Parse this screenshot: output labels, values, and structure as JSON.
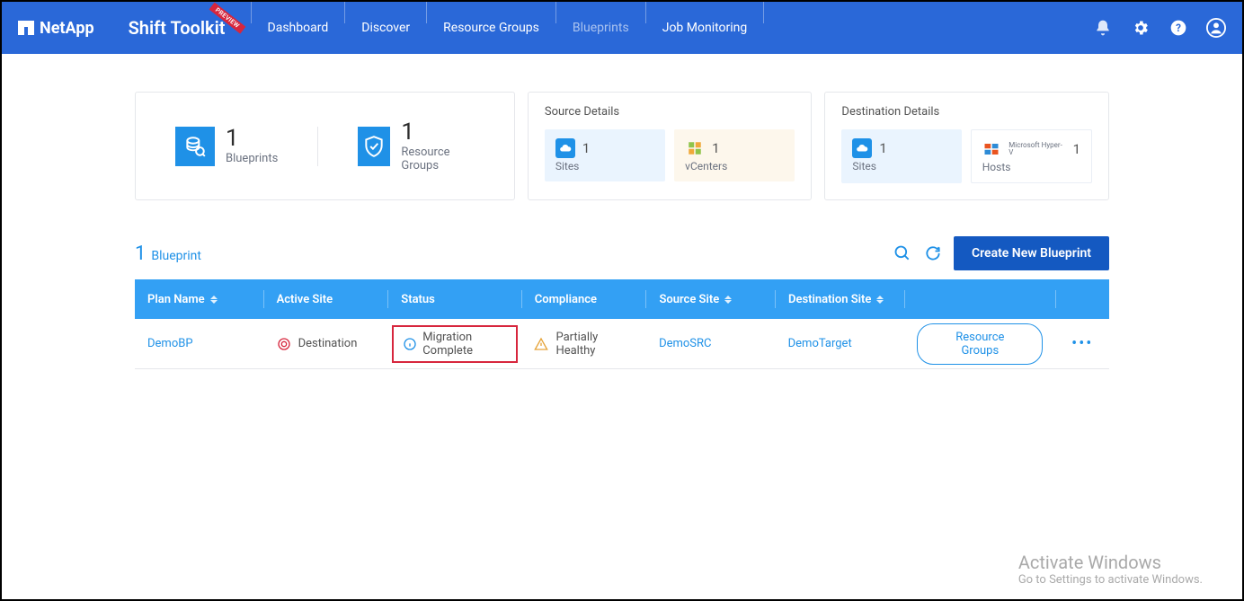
{
  "header": {
    "brand": "NetApp",
    "product": "Shift Toolkit",
    "ribbon": "PREVIEW",
    "nav": [
      "Dashboard",
      "Discover",
      "Resource Groups",
      "Blueprints",
      "Job Monitoring"
    ],
    "active_nav_index": 3
  },
  "summary": {
    "blueprints": {
      "count": "1",
      "label": "Blueprints"
    },
    "resource_groups": {
      "count": "1",
      "label": "Resource Groups"
    },
    "source": {
      "title": "Source Details",
      "sites": {
        "count": "1",
        "label": "Sites"
      },
      "vcenters": {
        "count": "1",
        "label": "vCenters"
      }
    },
    "destination": {
      "title": "Destination Details",
      "sites": {
        "count": "1",
        "label": "Sites"
      },
      "hosts": {
        "count": "1",
        "label": "Hosts",
        "sublabel": "Microsoft Hyper-V"
      }
    }
  },
  "table": {
    "count": "1",
    "label": "Blueprint",
    "create_button": "Create New Blueprint",
    "columns": {
      "plan": "Plan Name",
      "active": "Active Site",
      "status": "Status",
      "compliance": "Compliance",
      "source": "Source Site",
      "destination": "Destination Site"
    },
    "rows": [
      {
        "plan": "DemoBP",
        "active": "Destination",
        "status": "Migration Complete",
        "compliance": "Partially Healthy",
        "source": "DemoSRC",
        "destination": "DemoTarget",
        "rg_button": "Resource Groups"
      }
    ]
  },
  "watermark": {
    "title": "Activate Windows",
    "sub": "Go to Settings to activate Windows."
  }
}
